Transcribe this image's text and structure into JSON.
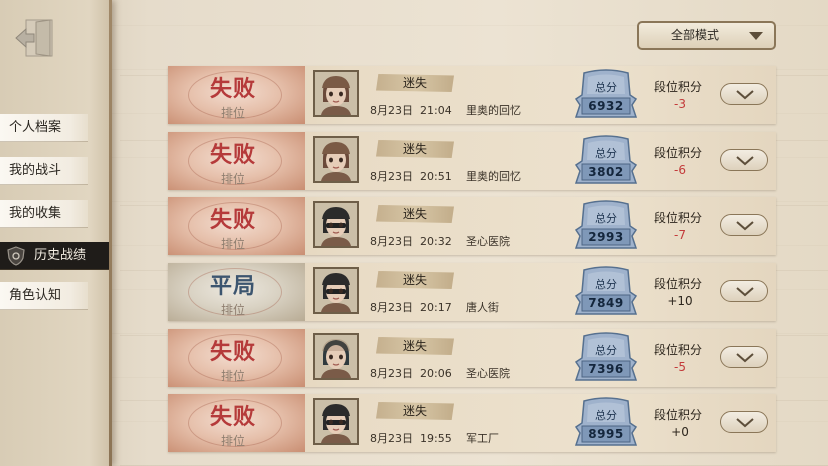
{
  "nav": {
    "items": [
      {
        "label": "个人档案",
        "active": false
      },
      {
        "label": "我的战斗",
        "active": false
      },
      {
        "label": "我的收集",
        "active": false
      },
      {
        "label": "历史战绩",
        "active": true
      },
      {
        "label": "角色认知",
        "active": false
      }
    ]
  },
  "mode_filter": {
    "label": "全部模式"
  },
  "row_labels": {
    "sub": "排位",
    "score_title": "总分",
    "rank_title": "段位积分"
  },
  "matches": [
    {
      "result": "失败",
      "type": "排位",
      "tag": "迷失",
      "date": "8月23日",
      "time": "21:04",
      "map": "里奥的回忆",
      "score": "6932",
      "rank_change": "-3"
    },
    {
      "result": "失败",
      "type": "排位",
      "tag": "迷失",
      "date": "8月23日",
      "time": "20:51",
      "map": "里奥的回忆",
      "score": "3802",
      "rank_change": "-6"
    },
    {
      "result": "失败",
      "type": "排位",
      "tag": "迷失",
      "date": "8月23日",
      "time": "20:32",
      "map": "圣心医院",
      "score": "2993",
      "rank_change": "-7"
    },
    {
      "result": "平局",
      "type": "排位",
      "tag": "迷失",
      "date": "8月23日",
      "time": "20:17",
      "map": "唐人街",
      "score": "7849",
      "rank_change": "+10"
    },
    {
      "result": "失败",
      "type": "排位",
      "tag": "迷失",
      "date": "8月23日",
      "time": "20:06",
      "map": "圣心医院",
      "score": "7396",
      "rank_change": "-5"
    },
    {
      "result": "失败",
      "type": "排位",
      "tag": "迷失",
      "date": "8月23日",
      "time": "19:55",
      "map": "军工厂",
      "score": "8995",
      "rank_change": "+0"
    }
  ],
  "colors": {
    "loss": "#b53a3a",
    "draw": "#3c556f",
    "negative": "#c33b3b",
    "badge": "#8fa7c4"
  },
  "icons": {
    "back": "exit-door-icon",
    "mode_chevron": "chevron-down-icon",
    "row_expand": "chevron-down-icon",
    "nav_active": "shield-icon"
  }
}
